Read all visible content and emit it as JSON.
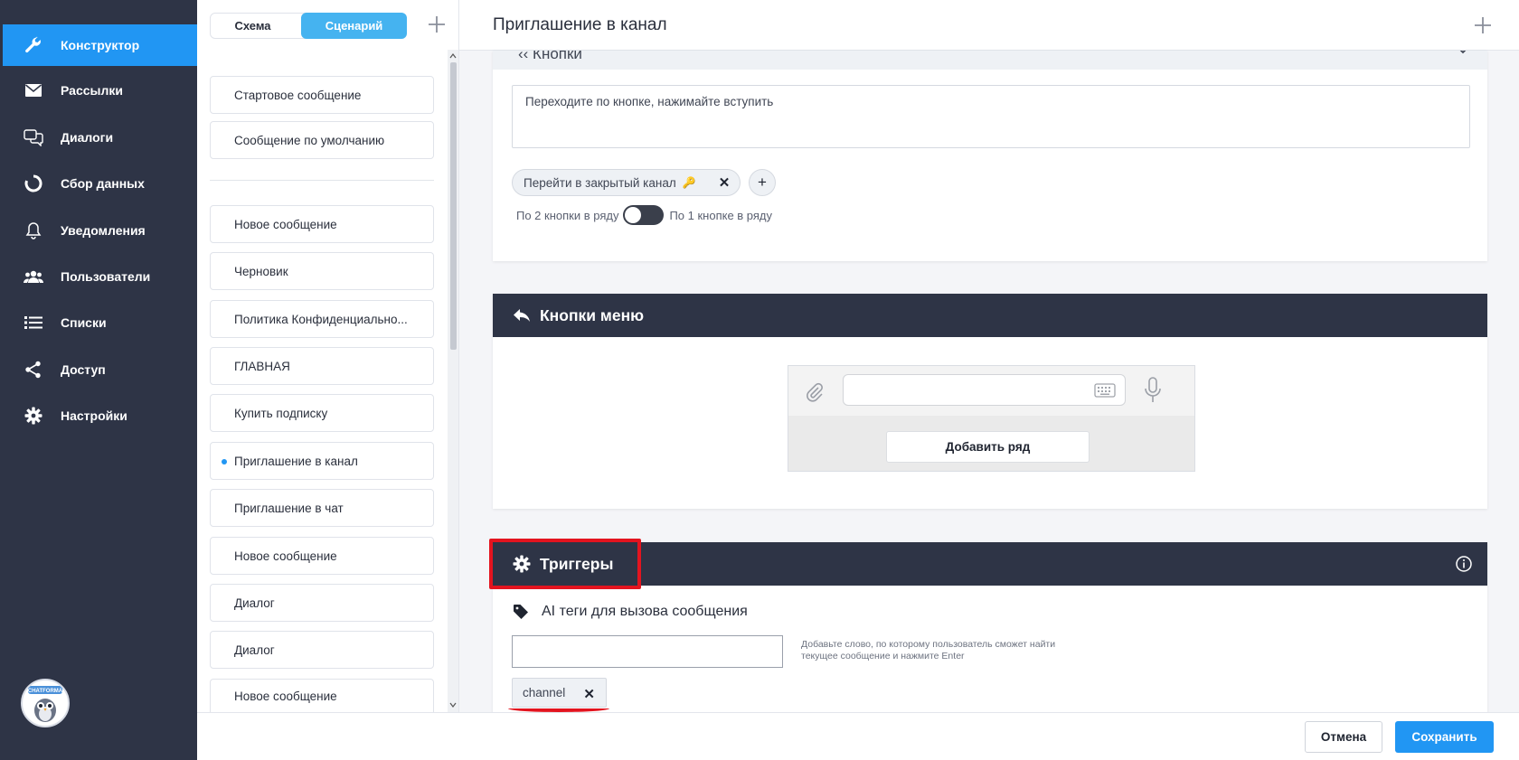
{
  "nav": {
    "items": [
      {
        "label": "Конструктор",
        "icon": "wrench-icon",
        "active": true
      },
      {
        "label": "Рассылки",
        "icon": "envelope-icon"
      },
      {
        "label": "Диалоги",
        "icon": "chat-bubbles-icon"
      },
      {
        "label": "Сбор данных",
        "icon": "circle-progress-icon"
      },
      {
        "label": "Уведомления",
        "icon": "bell-icon"
      },
      {
        "label": "Пользователи",
        "icon": "users-icon"
      },
      {
        "label": "Списки",
        "icon": "list-icon"
      },
      {
        "label": "Доступ",
        "icon": "share-icon"
      },
      {
        "label": "Настройки",
        "icon": "gear-icon"
      }
    ],
    "logo_text": "CHATFORMA"
  },
  "list": {
    "tabs": [
      {
        "label": "Схема",
        "active": false
      },
      {
        "label": "Сценарий",
        "active": true
      }
    ],
    "pinned": [
      "Стартовое сообщение",
      "Сообщение по умолчанию"
    ],
    "items": [
      "Новое сообщение",
      "Черновик",
      "Политика Конфиденциально...",
      "ГЛАВНАЯ",
      "Купить подписку",
      "Приглашение в канал",
      "Приглашение в чат",
      "Новое сообщение",
      "Диалог",
      "Диалог",
      "Новое сообщение"
    ],
    "active_item": "Приглашение в канал"
  },
  "main": {
    "title": "Приглашение в канал",
    "buttons_section": {
      "label": "Кнопки",
      "message_text": "Переходите по кнопке, нажимайте вступить",
      "button_chip": "Перейти в закрытый канал",
      "button_chip_emoji": "🔑",
      "layout_left": "По 2 кнопки в ряду",
      "layout_right": "По 1 кнопке в ряду",
      "toggle_on": false
    },
    "menu_section": {
      "title": "Кнопки меню",
      "add_row": "Добавить ряд"
    },
    "triggers_section": {
      "title": "Триггеры",
      "ai_label": "AI теги для вызова сообщения",
      "input_value": "",
      "hint": "Добавьте слово, по которому пользователь сможет найти текущее сообщение и нажмите Enter",
      "tags": [
        "channel"
      ]
    }
  },
  "footer": {
    "cancel": "Отмена",
    "save": "Сохранить"
  },
  "colors": {
    "nav_bg": "#2e3446",
    "accent": "#2196f3",
    "segment_active": "#45b3f0",
    "highlight_red": "#e3141f"
  }
}
